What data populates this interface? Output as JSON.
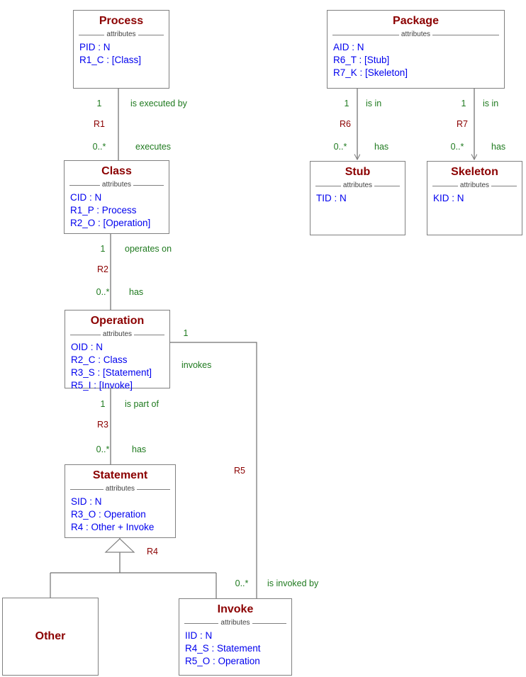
{
  "diagram": {
    "title": "UML class diagram",
    "colors": {
      "class_name": "#8b0000",
      "attribute": "#0000ee",
      "role_label": "#1f7a1f",
      "relation_label": "#8b0000",
      "line": "#808080",
      "background": "#ffffff"
    },
    "attributes_caption": "attributes"
  },
  "classes": [
    {
      "id": "process",
      "name": "Process",
      "attributes": [
        "PID : N",
        "R1_C : [Class]"
      ]
    },
    {
      "id": "package",
      "name": "Package",
      "attributes": [
        "AID : N",
        "R6_T : [Stub]",
        "R7_K : [Skeleton]"
      ]
    },
    {
      "id": "class",
      "name": "Class",
      "attributes": [
        "CID : N",
        "R1_P : Process",
        "R2_O : [Operation]"
      ]
    },
    {
      "id": "stub",
      "name": "Stub",
      "attributes": [
        "TID : N"
      ]
    },
    {
      "id": "skeleton",
      "name": "Skeleton",
      "attributes": [
        "KID : N"
      ]
    },
    {
      "id": "operation",
      "name": "Operation",
      "attributes": [
        "OID : N",
        "R2_C : Class",
        "R3_S : [Statement]",
        "R5_I : [Invoke]"
      ]
    },
    {
      "id": "statement",
      "name": "Statement",
      "attributes": [
        "SID : N",
        "R3_O : Operation",
        "R4 : Other + Invoke"
      ]
    },
    {
      "id": "other",
      "name": "Other",
      "attributes": []
    },
    {
      "id": "invoke",
      "name": "Invoke",
      "attributes": [
        "IID : N",
        "R4_S : Statement",
        "R5_O : Operation"
      ]
    }
  ],
  "relationships": [
    {
      "id": "R1",
      "label": "R1",
      "from": "Process",
      "to": "Class",
      "from_multiplicity": "1",
      "to_multiplicity": "0..*",
      "from_role": "is executed by",
      "to_role": "executes"
    },
    {
      "id": "R2",
      "label": "R2",
      "from": "Class",
      "to": "Operation",
      "from_multiplicity": "1",
      "to_multiplicity": "0..*",
      "from_role": "operates on",
      "to_role": "has"
    },
    {
      "id": "R3",
      "label": "R3",
      "from": "Operation",
      "to": "Statement",
      "from_multiplicity": "1",
      "to_multiplicity": "0..*",
      "from_role": "is part of",
      "to_role": "has"
    },
    {
      "id": "R4",
      "label": "R4",
      "from": "Statement",
      "to": "Other + Invoke",
      "kind": "generalization"
    },
    {
      "id": "R5",
      "label": "R5",
      "from": "Operation",
      "to": "Invoke",
      "from_multiplicity": "1",
      "to_multiplicity": "0..*",
      "from_role": "invokes",
      "to_role": "is invoked by"
    },
    {
      "id": "R6",
      "label": "R6",
      "from": "Package",
      "to": "Stub",
      "from_multiplicity": "1",
      "to_multiplicity": "0..*",
      "from_role": "is in",
      "to_role": "has"
    },
    {
      "id": "R7",
      "label": "R7",
      "from": "Package",
      "to": "Skeleton",
      "from_multiplicity": "1",
      "to_multiplicity": "0..*",
      "from_role": "is in",
      "to_role": "has"
    }
  ]
}
